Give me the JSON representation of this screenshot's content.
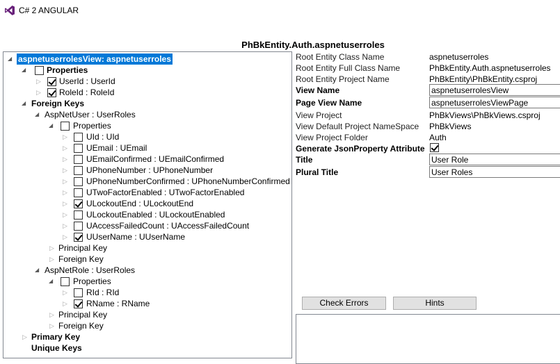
{
  "app": {
    "title": "C# 2 ANGULAR"
  },
  "heading": "PhBkEntity.Auth.aspnetuserroles",
  "tree": {
    "root_label": "aspnetuserrolesView: aspnetuserroles",
    "properties_label": "Properties",
    "userid": "UserId : UserId",
    "roleid": "RoleId : RoleId",
    "foreign_keys_label": "Foreign Keys",
    "aspnetuser": "AspNetUser : UserRoles",
    "aspnetuser_properties": "Properties",
    "aspnetuser_props": [
      {
        "label": "UId : UId",
        "checked": false
      },
      {
        "label": "UEmail : UEmail",
        "checked": false
      },
      {
        "label": "UEmailConfirmed : UEmailConfirmed",
        "checked": false
      },
      {
        "label": "UPhoneNumber : UPhoneNumber",
        "checked": false
      },
      {
        "label": "UPhoneNumberConfirmed : UPhoneNumberConfirmed",
        "checked": false
      },
      {
        "label": "UTwoFactorEnabled : UTwoFactorEnabled",
        "checked": false
      },
      {
        "label": "ULockoutEnd : ULockoutEnd",
        "checked": true
      },
      {
        "label": "ULockoutEnabled : ULockoutEnabled",
        "checked": false
      },
      {
        "label": "UAccessFailedCount : UAccessFailedCount",
        "checked": false
      },
      {
        "label": "UUserName : UUserName",
        "checked": true
      }
    ],
    "aspnetuser_principal_key": "Principal Key",
    "aspnetuser_foreign_key": "Foreign Key",
    "aspnetrole": "AspNetRole : UserRoles",
    "aspnetrole_properties": "Properties",
    "rid": "RId : RId",
    "rname": "RName : RName",
    "aspnetrole_principal_key": "Principal Key",
    "aspnetrole_foreign_key": "Foreign Key",
    "primary_key_label": "Primary Key",
    "unique_keys_label": "Unique Keys"
  },
  "props": {
    "root_entity_class_name_label": "Root Entity Class Name",
    "root_entity_class_name": "aspnetuserroles",
    "root_entity_full_class_name_label": "Root Entity Full Class Name",
    "root_entity_full_class_name": "PhBkEntity.Auth.aspnetuserroles",
    "root_entity_project_name_label": "Root Entity Project Name",
    "root_entity_project_name": "PhBkEntity\\PhBkEntity.csproj",
    "view_name_label": "View Name",
    "view_name": "aspnetuserrolesView",
    "page_view_name_label": "Page View Name",
    "page_view_name": "aspnetuserrolesViewPage",
    "view_project_label": "View Project",
    "view_project": "PhBkViews\\PhBkViews.csproj",
    "view_default_namespace_label": "View Default Project NameSpace",
    "view_default_namespace": "PhBkViews",
    "view_project_folder_label": "View Project Folder",
    "view_project_folder": "Auth",
    "generate_json_label": "Generate JsonProperty Attribute",
    "generate_json_checked": true,
    "title_label": "Title",
    "title": "User Role",
    "plural_title_label": "Plural Title",
    "plural_title": "User Roles"
  },
  "buttons": {
    "check_errors": "Check Errors",
    "hints": "Hints"
  }
}
